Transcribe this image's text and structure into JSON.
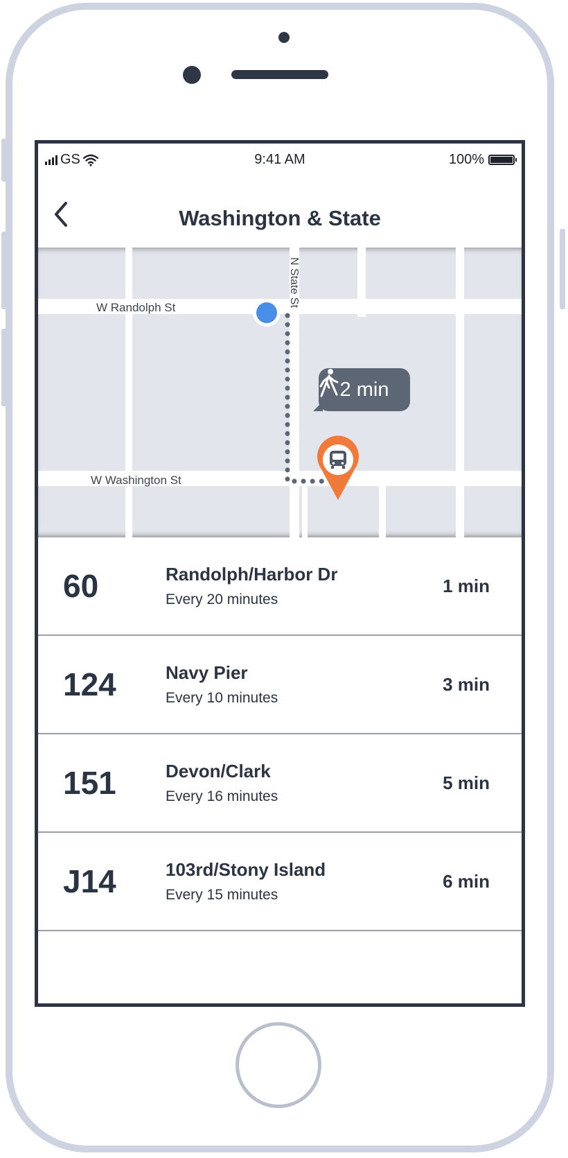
{
  "status_bar": {
    "carrier": "GS",
    "time": "9:41 AM",
    "battery_percent": "100%",
    "battery_level": 1.0
  },
  "nav": {
    "title": "Washington & State",
    "back_icon": "chevron-left-icon"
  },
  "map": {
    "street_randolph": "W Randolph St",
    "street_washington": "W Washington St",
    "street_state": "N State St",
    "walk_time": "2 min",
    "walk_icon": "walking-person-icon",
    "stop_icon": "bus-pin-icon",
    "user_location_color": "#4a8fe7",
    "pin_color": "#f07a3a"
  },
  "routes": [
    {
      "number": "60",
      "name": "Randolph/Harbor Dr",
      "frequency": "Every 20 minutes",
      "eta": "1 min"
    },
    {
      "number": "124",
      "name": "Navy Pier",
      "frequency": "Every 10 minutes",
      "eta": "3 min"
    },
    {
      "number": "151",
      "name": "Devon/Clark",
      "frequency": "Every 16 minutes",
      "eta": "5 min"
    },
    {
      "number": "J14",
      "name": "103rd/Stony Island",
      "frequency": "Every 15 minutes",
      "eta": "6 min"
    }
  ],
  "colors": {
    "text_dark": "#2b3443",
    "map_block": "#e2e6ec",
    "device_frame": "#cdd3e0"
  }
}
